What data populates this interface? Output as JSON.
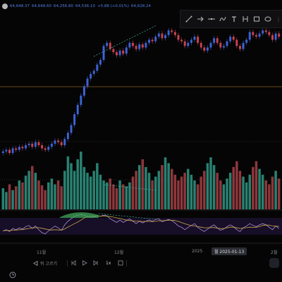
{
  "ohlc": {
    "values": [
      "64,648.37",
      "64,648.60",
      "64,256.80",
      "64,536.10",
      "+5.88 (+0.01%)",
      "64,628.24"
    ]
  },
  "toolbar": {
    "tools": [
      "trend-line",
      "arrow",
      "horizontal-line",
      "pen",
      "text",
      "measure",
      "rectangle",
      "ellipse"
    ]
  },
  "time_axis": {
    "labels": [
      "11월",
      "12월",
      "2025",
      "2월"
    ],
    "crosshair": "월 2025-01-13"
  },
  "playback": {
    "back_label": "뒤 고르기",
    "speed_label": "1x"
  },
  "colors": {
    "up": "#3d63d6",
    "down": "#c8434f",
    "vol_up": "#2e8f7d",
    "vol_down": "#9c3d43",
    "ma": "#c9a84a",
    "rsi": "#a98bd4",
    "divergence": "#3fb6a3"
  },
  "chart_data": {
    "type": "candlestick",
    "title": "",
    "xlabel": "",
    "ylabel": "",
    "close": [
      16,
      17,
      15,
      18,
      17,
      19,
      18,
      20,
      21,
      19,
      22,
      20,
      18,
      17,
      19,
      21,
      23,
      22,
      20,
      24,
      28,
      33,
      40,
      46,
      52,
      58,
      63,
      66,
      68,
      72,
      75,
      84,
      86,
      82,
      80,
      78,
      81,
      79,
      83,
      86,
      84,
      82,
      85,
      83,
      86,
      88,
      87,
      90,
      92,
      89,
      91,
      94,
      93,
      91,
      88,
      87,
      84,
      86,
      88,
      90,
      86,
      83,
      81,
      83,
      86,
      89,
      86,
      83,
      84,
      87,
      90,
      88,
      84,
      82,
      86,
      88,
      93,
      91,
      90,
      92,
      94,
      93,
      91,
      88,
      92,
      90
    ],
    "volume": [
      22,
      18,
      26,
      20,
      24,
      30,
      28,
      35,
      40,
      45,
      38,
      30,
      25,
      20,
      28,
      32,
      26,
      30,
      24,
      40,
      55,
      48,
      40,
      52,
      60,
      44,
      38,
      34,
      40,
      48,
      36,
      30,
      28,
      32,
      26,
      22,
      30,
      26,
      24,
      28,
      34,
      40,
      46,
      52,
      44,
      38,
      30,
      34,
      40,
      46,
      54,
      48,
      42,
      36,
      30,
      34,
      38,
      42,
      36,
      30,
      26,
      34,
      40,
      48,
      54,
      46,
      38,
      30,
      26,
      32,
      38,
      44,
      50,
      40,
      34,
      28,
      36,
      44,
      50,
      42,
      36,
      30,
      26,
      34,
      40,
      32
    ],
    "rsi": [
      48,
      50,
      47,
      52,
      50,
      53,
      51,
      55,
      57,
      52,
      56,
      50,
      45,
      43,
      48,
      52,
      56,
      53,
      49,
      58,
      64,
      68,
      72,
      74,
      75,
      74,
      72,
      70,
      71,
      73,
      72,
      74,
      73,
      68,
      65,
      62,
      66,
      62,
      65,
      68,
      64,
      60,
      64,
      61,
      64,
      66,
      64,
      67,
      68,
      63,
      65,
      67,
      65,
      61,
      56,
      54,
      50,
      54,
      57,
      60,
      54,
      50,
      47,
      51,
      55,
      58,
      53,
      49,
      51,
      55,
      58,
      55,
      50,
      47,
      53,
      56,
      60,
      57,
      55,
      58,
      60,
      58,
      54,
      50,
      56,
      52
    ]
  }
}
